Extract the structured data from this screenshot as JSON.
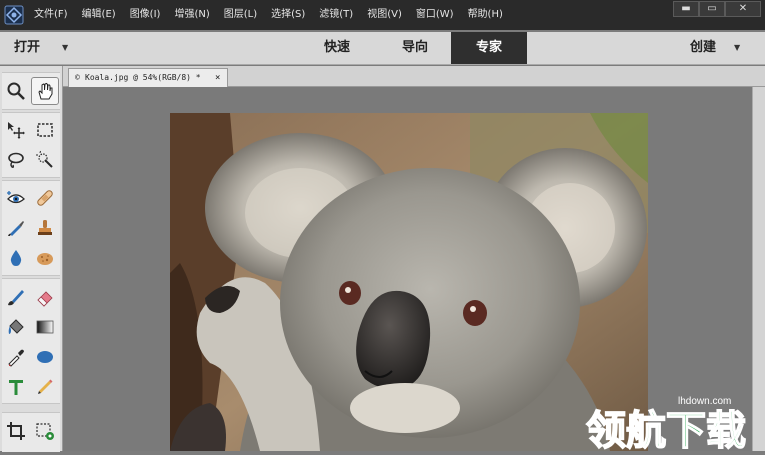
{
  "menubar": {
    "items": [
      "文件(F)",
      "编辑(E)",
      "图像(I)",
      "增强(N)",
      "图层(L)",
      "选择(S)",
      "滤镜(T)",
      "视图(V)",
      "窗口(W)",
      "帮助(H)"
    ],
    "minimize": "▬",
    "maximize": "▭",
    "close": "✕"
  },
  "modebar": {
    "open_label": "打开",
    "open_caret": "▼",
    "modes": [
      "快速",
      "导向",
      "专家"
    ],
    "active_mode": "专家",
    "create_label": "创建",
    "create_caret": "▼"
  },
  "document_tab": {
    "icon": "©",
    "title": "Koala.jpg @ 54%(RGB/8) *",
    "close": "×"
  },
  "tools": [
    {
      "name": "zoom-tool",
      "icon": "magnifier-icon"
    },
    {
      "name": "hand-tool",
      "icon": "hand-icon",
      "selected": true
    },
    {
      "name": "move-tool",
      "icon": "move-arrows-icon"
    },
    {
      "name": "rectangular-marquee-tool",
      "icon": "marquee-icon"
    },
    {
      "name": "lasso-tool",
      "icon": "lasso-icon"
    },
    {
      "name": "quick-selection-tool",
      "icon": "magic-wand-icon"
    },
    {
      "name": "red-eye-tool",
      "icon": "eye-icon"
    },
    {
      "name": "spot-healing-brush-tool",
      "icon": "bandage-icon"
    },
    {
      "name": "smart-brush-tool",
      "icon": "brush-icon"
    },
    {
      "name": "clone-stamp-tool",
      "icon": "stamp-icon"
    },
    {
      "name": "blur-tool",
      "icon": "water-drop-icon"
    },
    {
      "name": "sponge-tool",
      "icon": "sponge-icon"
    },
    {
      "name": "brush-tool",
      "icon": "paintbrush-icon"
    },
    {
      "name": "eraser-tool",
      "icon": "eraser-icon"
    },
    {
      "name": "paint-bucket-tool",
      "icon": "paint-bucket-icon"
    },
    {
      "name": "gradient-tool",
      "icon": "gradient-icon"
    },
    {
      "name": "eyedropper-tool",
      "icon": "eyedropper-icon"
    },
    {
      "name": "shape-tool",
      "icon": "ellipse-icon"
    },
    {
      "name": "type-tool",
      "icon": "type-t-icon"
    },
    {
      "name": "pencil-tool",
      "icon": "pencil-icon"
    },
    {
      "name": "crop-tool",
      "icon": "crop-icon"
    },
    {
      "name": "recompose-tool",
      "icon": "recompose-icon"
    }
  ],
  "canvas": {
    "image_subject": "koala"
  },
  "watermark": {
    "url": "lhdown.com",
    "logo_text": "领航下载"
  },
  "colors": {
    "menubar_bg": "#2a2a2a",
    "modebar_bg": "#d8d8d8",
    "active_mode_bg": "#2f2f2f",
    "canvas_bg": "#7a7a7a",
    "watermark_green": "#1fa64a"
  }
}
